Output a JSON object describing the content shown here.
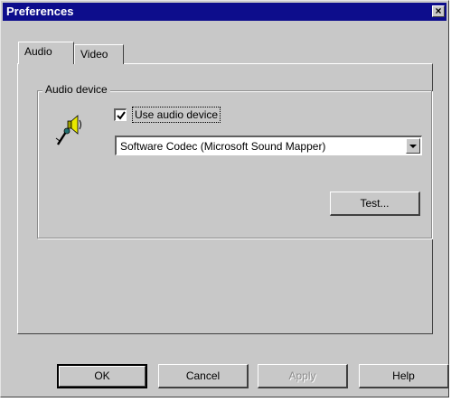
{
  "window": {
    "title": "Preferences",
    "close_glyph": "×"
  },
  "tabs": [
    {
      "label": "Audio",
      "active": true
    },
    {
      "label": "Video",
      "active": false
    }
  ],
  "audio_device": {
    "group_label": "Audio device",
    "icon": "speaker-microphone-icon",
    "use_audio_device": {
      "label": "Use audio device",
      "checked": true
    },
    "device_select": {
      "value": "Software Codec (Microsoft Sound Mapper)"
    },
    "test_label": "Test..."
  },
  "buttons": {
    "ok": "OK",
    "cancel": "Cancel",
    "apply": "Apply",
    "help": "Help"
  },
  "colors": {
    "titlebar": "#0d0d8c",
    "face": "#c8c8c8"
  }
}
